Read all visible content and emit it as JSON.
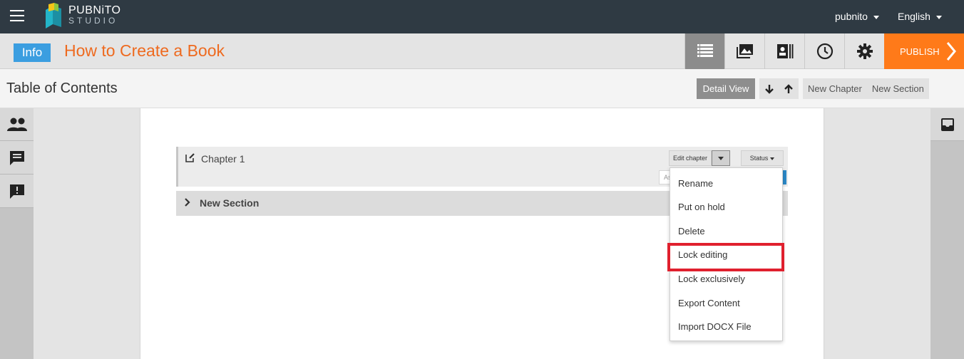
{
  "topbar": {
    "logo_line1": "PUBNiTO",
    "logo_line2": "STUDIO",
    "user": "pubnito",
    "language": "English"
  },
  "titlebar": {
    "info_label": "Info",
    "book_title": "How to Create a Book",
    "publish_label": "PUBLISH"
  },
  "subheader": {
    "title": "Table of Contents",
    "detail_view": "Detail View",
    "new_chapter": "New Chapter",
    "new_section": "New Section"
  },
  "chapter": {
    "name": "Chapter 1",
    "edit_label": "Edit chapter",
    "status_label": "Status",
    "assign_fragment": "As"
  },
  "section": {
    "name": "New Section"
  },
  "menu": {
    "items": [
      "Rename",
      "Put on hold",
      "Delete",
      "Lock editing",
      "Lock exclusively",
      "Export Content",
      "Import DOCX File"
    ],
    "highlighted": "Lock editing"
  },
  "colors": {
    "topbar": "#2f3a43",
    "accent_orange": "#ff7a19",
    "title_orange": "#ee6a1f",
    "info_blue": "#3b9ee0",
    "highlight_red": "#e0202e"
  }
}
